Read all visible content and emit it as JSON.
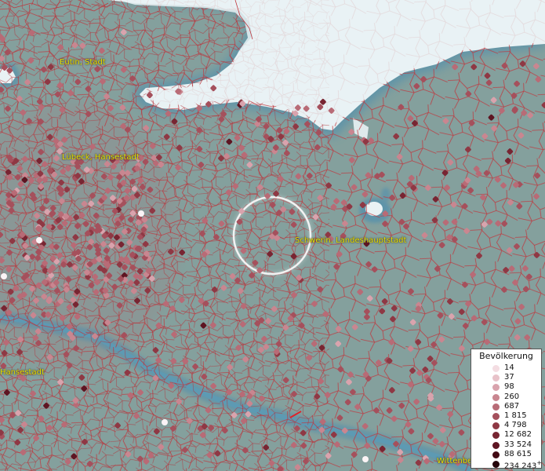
{
  "map": {
    "cities": [
      {
        "id": "eutin",
        "label": "Eutin, Stadt"
      },
      {
        "id": "luebeck",
        "label": "Lübeck, Hansestadt"
      },
      {
        "id": "schwerin",
        "label": "Schwerin, Landeshauptstadt"
      },
      {
        "id": "hansestadt",
        "label": "Hansestadt"
      },
      {
        "id": "wittenberge",
        "label": "Wittenbe"
      }
    ],
    "colors": {
      "land": "#7f9c98",
      "water": "#e8f1f3",
      "river": "#4f8fae",
      "boundary": "#c0353c",
      "label": "#e8e000"
    }
  },
  "legend": {
    "title": "Bevölkerung",
    "classes": [
      {
        "label": "14",
        "color": "#f4dde2"
      },
      {
        "label": "37",
        "color": "#e8c2c9"
      },
      {
        "label": "98",
        "color": "#d9a3ad"
      },
      {
        "label": "260",
        "color": "#c98690"
      },
      {
        "label": "687",
        "color": "#b86b76"
      },
      {
        "label": "1 815",
        "color": "#a5505c"
      },
      {
        "label": "4 798",
        "color": "#8f3844"
      },
      {
        "label": "12 682",
        "color": "#782532"
      },
      {
        "label": "33 524",
        "color": "#5e1522"
      },
      {
        "label": "88 615",
        "color": "#430a14"
      },
      {
        "label": "234 243",
        "color": "#25040a",
        "plus": "+"
      }
    ]
  }
}
